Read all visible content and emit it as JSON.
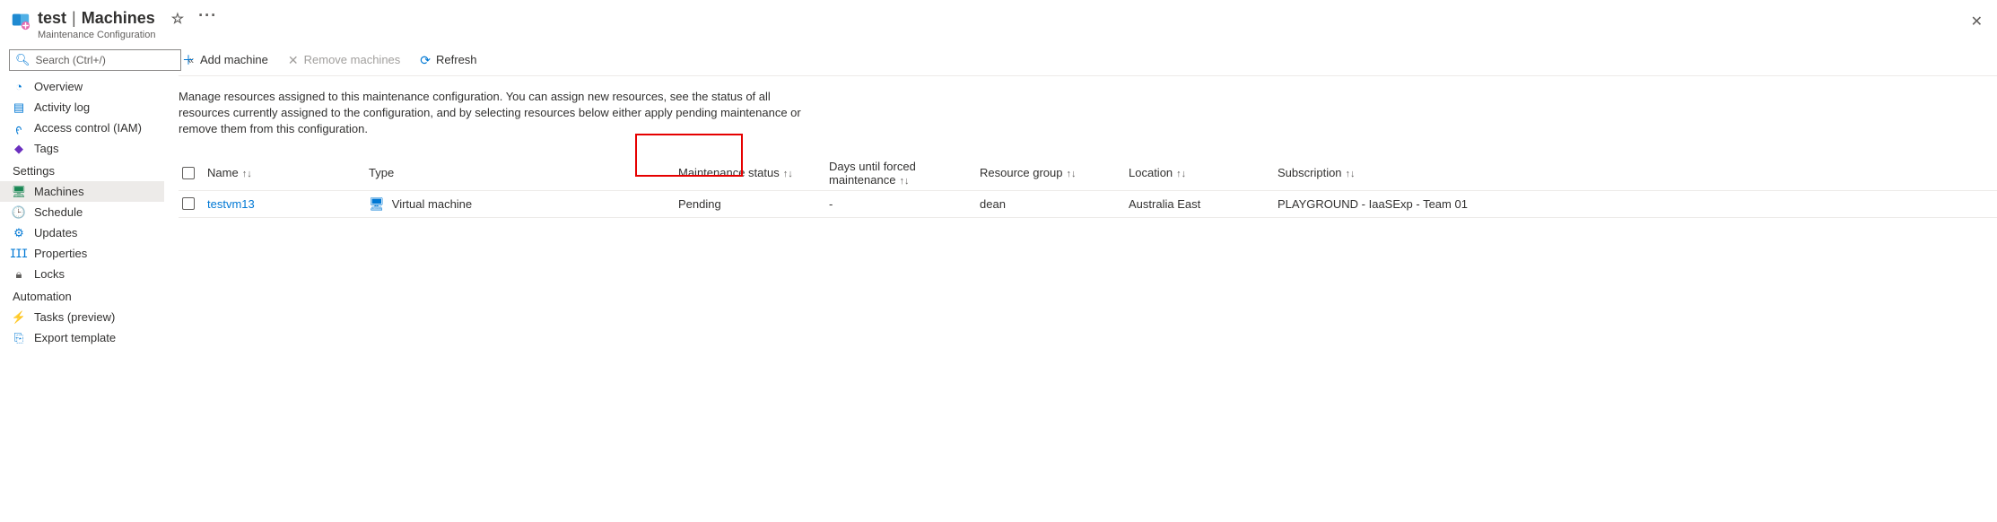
{
  "header": {
    "resource_name": "test",
    "page_name": "Machines",
    "subtitle": "Maintenance Configuration"
  },
  "search": {
    "placeholder": "Search (Ctrl+/)"
  },
  "sidebar": {
    "overview": "Overview",
    "activity_log": "Activity log",
    "access_control": "Access control (IAM)",
    "tags": "Tags",
    "group_settings": "Settings",
    "machines": "Machines",
    "schedule": "Schedule",
    "updates": "Updates",
    "properties": "Properties",
    "locks": "Locks",
    "group_automation": "Automation",
    "tasks": "Tasks (preview)",
    "export_template": "Export template"
  },
  "toolbar": {
    "add_machine": "Add machine",
    "remove_machines": "Remove machines",
    "refresh": "Refresh"
  },
  "description": "Manage resources assigned to this maintenance configuration. You can assign new resources, see the status of all resources currently assigned to the configuration, and by selecting resources below either apply pending maintenance or remove them from this configuration.",
  "table": {
    "columns": {
      "name": "Name",
      "type": "Type",
      "maintenance_status": "Maintenance status",
      "days_until": "Days until forced maintenance",
      "resource_group": "Resource group",
      "location": "Location",
      "subscription": "Subscription"
    },
    "rows": [
      {
        "name": "testvm13",
        "type": "Virtual machine",
        "maintenance_status": "Pending",
        "days_until": "-",
        "resource_group": "dean",
        "location": "Australia East",
        "subscription": "PLAYGROUND - IaaSExp - Team 01"
      }
    ]
  }
}
